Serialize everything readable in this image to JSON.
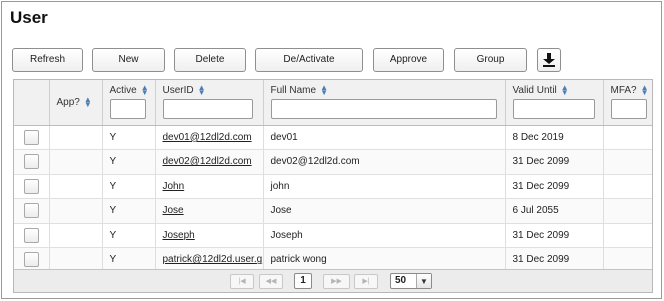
{
  "page": {
    "title": "User"
  },
  "toolbar": {
    "refresh_label": "Refresh",
    "new_label": "New",
    "delete_label": "Delete",
    "deactivate_label": "De/Activate",
    "approve_label": "Approve",
    "group_label": "Group",
    "download_icon": "download-icon"
  },
  "table": {
    "columns": {
      "app": "App?",
      "active": "Active",
      "userid": "UserID",
      "fullname": "Full Name",
      "validuntil": "Valid Until",
      "mfa": "MFA?"
    },
    "rows": [
      {
        "app": "",
        "active": "Y",
        "userid": "dev01@12dl2d.com",
        "fullname": "dev01",
        "validuntil": "8 Dec 2019",
        "mfa": ""
      },
      {
        "app": "",
        "active": "Y",
        "userid": "dev02@12dl2d.com",
        "fullname": "dev02@12dl2d.com",
        "validuntil": "31 Dec 2099",
        "mfa": ""
      },
      {
        "app": "",
        "active": "Y",
        "userid": "John",
        "fullname": "john",
        "validuntil": "31 Dec 2099",
        "mfa": ""
      },
      {
        "app": "",
        "active": "Y",
        "userid": "Jose",
        "fullname": "Jose",
        "validuntil": "6 Jul 2055",
        "mfa": ""
      },
      {
        "app": "",
        "active": "Y",
        "userid": "Joseph",
        "fullname": "Joseph",
        "validuntil": "31 Dec 2099",
        "mfa": ""
      },
      {
        "app": "",
        "active": "Y",
        "userid": "patrick@12dl2d.user.g",
        "fullname": "patrick wong",
        "validuntil": "31 Dec 2099",
        "mfa": ""
      }
    ]
  },
  "pager": {
    "first": "|◀",
    "prev": "◀◀",
    "current_page": "1",
    "next": "▶▶",
    "last": "▶|",
    "page_size": "50"
  }
}
